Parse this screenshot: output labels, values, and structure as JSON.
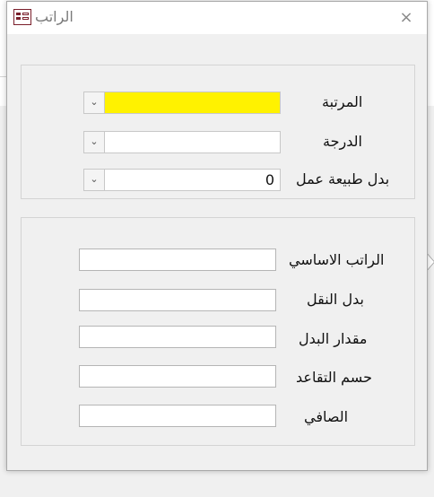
{
  "window": {
    "title": "الراتب",
    "close_glyph": "×"
  },
  "group1": {
    "fields": [
      {
        "label": "المرتبة",
        "value": "",
        "bg": "#fff200"
      },
      {
        "label": "الدرجة",
        "value": "",
        "bg": "#ffffff"
      },
      {
        "label": "بدل طبيعة عمل",
        "value": "0",
        "bg": "#ffffff"
      }
    ]
  },
  "group2": {
    "fields": [
      {
        "label": "الراتب الاساسي",
        "value": ""
      },
      {
        "label": "بدل النقل",
        "value": ""
      },
      {
        "label": "مقدار البدل",
        "value": ""
      },
      {
        "label": "حسم التقاعد",
        "value": ""
      },
      {
        "label": "الصافي",
        "value": ""
      }
    ]
  },
  "icons": {
    "window_icon": "form-icon",
    "dropdown": "chevron-down-icon",
    "close": "close-icon"
  },
  "colors": {
    "highlight": "#fff200",
    "title_text": "#7a7a7a"
  }
}
